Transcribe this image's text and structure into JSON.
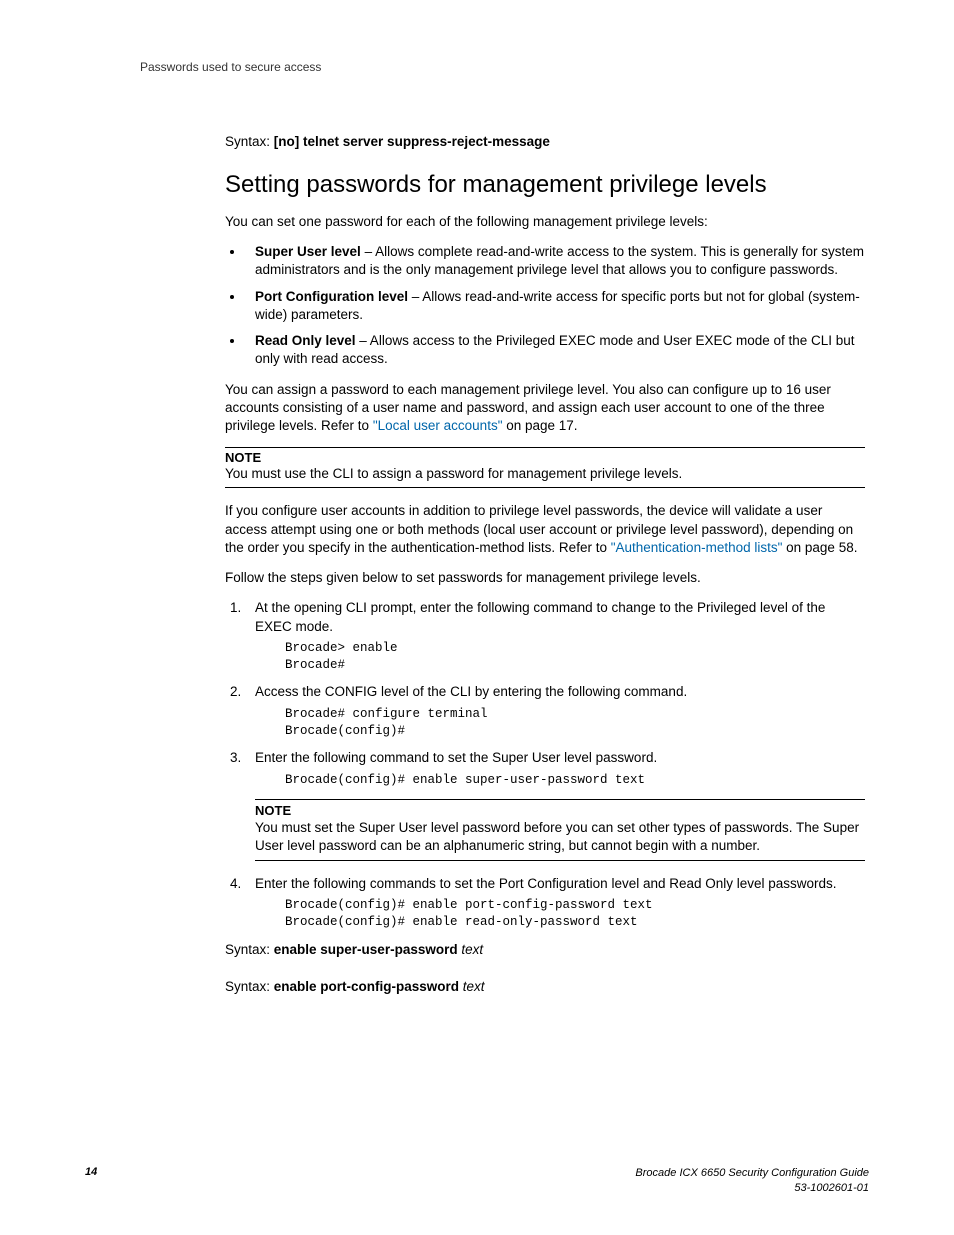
{
  "header": {
    "running": "Passwords used to secure access"
  },
  "syntax1": {
    "label": "Syntax:  ",
    "cmd": "[no] telnet server suppress-reject-message"
  },
  "h2": "Setting passwords for management privilege levels",
  "intro": "You can set one password for each of the following management privilege levels:",
  "bullets": {
    "b1_bold": "Super User level",
    "b1_rest": " – Allows complete read-and-write access to the system. This is generally for system administrators and is the only management privilege level that allows you to configure passwords.",
    "b2_bold": "Port Configuration level",
    "b2_rest": " – Allows read-and-write access for specific ports but not for global (system-wide) parameters.",
    "b3_bold": "Read Only level",
    "b3_rest": " – Allows access to the Privileged EXEC mode and User EXEC mode of the CLI but only with read access."
  },
  "para2_pre": "You can assign a password to each management privilege level. You also can configure up to 16 user accounts consisting of a user name and password, and assign each user account to one of the three privilege levels. Refer to ",
  "para2_link": "\"Local user accounts\"",
  "para2_post": " on page 17.",
  "note1_title": "NOTE",
  "note1_body": "You must use the CLI to assign a password for management privilege levels.",
  "para3_pre": "If you configure user accounts in addition to privilege level passwords, the device will validate a user access attempt using one or both methods (local user account or privilege level password), depending on the order you specify in the authentication-method lists. Refer to ",
  "para3_link": "\"Authentication-method lists\"",
  "para3_post": " on page 58.",
  "para4": "Follow the steps given below to set passwords for management privilege levels.",
  "step1": "At the opening CLI prompt, enter the following command to change to the Privileged level of the EXEC mode.",
  "code1": "Brocade> enable\nBrocade#",
  "step2": "Access the CONFIG level of the CLI by entering the following command.",
  "code2": "Brocade# configure terminal\nBrocade(config)#",
  "step3": "Enter the following command to set the Super User level password.",
  "code3": "Brocade(config)# enable super-user-password text",
  "note2_title": "NOTE",
  "note2_body": "You must set the Super User level password before you can set other types of passwords. The Super User level password can be an alphanumeric string, but cannot begin with a number.",
  "step4": "Enter the following commands to set the Port Configuration level and Read Only level passwords.",
  "code4": "Brocade(config)# enable port-config-password text\nBrocade(config)# enable read-only-password text",
  "syntax2": {
    "label": "Syntax:  ",
    "cmd": "enable super-user-password ",
    "arg": "text"
  },
  "syntax3": {
    "label": "Syntax:  ",
    "cmd": "enable port-config-password ",
    "arg": "text"
  },
  "footer": {
    "page": "14",
    "title": "Brocade ICX 6650 Security Configuration Guide",
    "docnum": "53-1002601-01"
  }
}
